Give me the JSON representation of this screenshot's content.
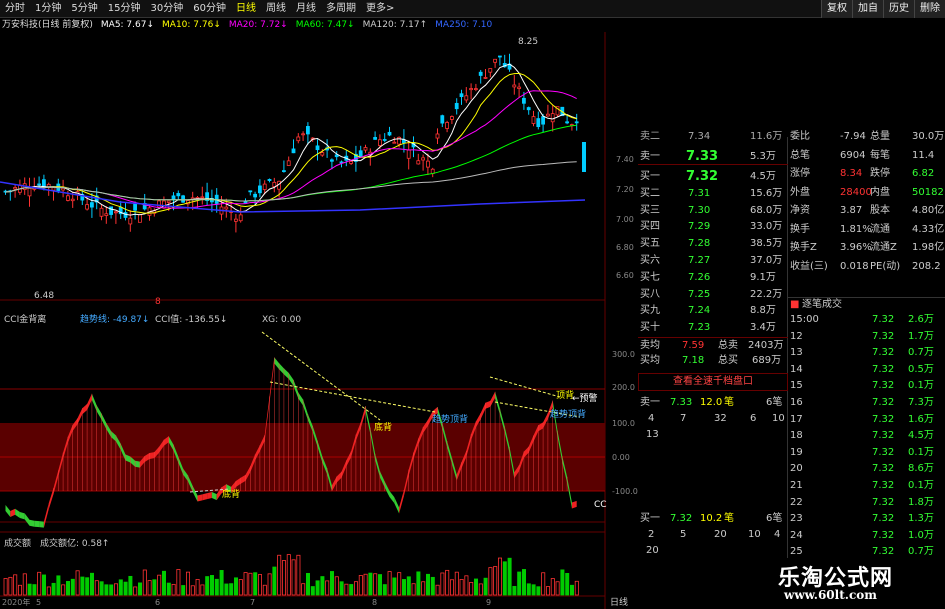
{
  "toolbar": {
    "periods": [
      "分时",
      "1分钟",
      "5分钟",
      "15分钟",
      "30分钟",
      "60分钟",
      "日线",
      "周线",
      "月线",
      "多周期",
      "更多>"
    ],
    "active_period": "日线",
    "right_buttons": [
      "复权",
      "加自",
      "历史",
      "删除"
    ]
  },
  "ma_bar": {
    "stock": "万安科技(日线 前复权)",
    "ma5": "MA5: 7.67↓",
    "ma10": "MA10: 7.76↓",
    "ma20": "MA20: 7.72↓",
    "ma60": "MA60: 7.47↓",
    "ma120": "MA120: 7.17↑",
    "ma250": "MA250: 7.10",
    "colors": {
      "ma5": "#ffffff",
      "ma10": "#ffff00",
      "ma20": "#ff00ff",
      "ma60": "#00ff00",
      "ma120": "#cccccc",
      "ma250": "#3366ff"
    }
  },
  "price_axis": {
    "top_label": "8.25",
    "low_label": "6.48",
    "ticks": [
      "7.40",
      "7.20",
      "7.00",
      "6.80",
      "6.60"
    ]
  },
  "cci_panel": {
    "title": "CCI金背离",
    "trend": "趋势线: -49.87↓",
    "cci": "CCI值: -136.55↓",
    "xg": "XG: 0.00",
    "axis": [
      "300.0",
      "200.0",
      "100.0",
      "0.00",
      "-100.0"
    ],
    "labels": {
      "top_back": "顶背",
      "bottom_back_1": "底背",
      "bottom_back_2": "底背",
      "trend_back": "趋势顶背",
      "trend_back_2": "趋势顶背",
      "top_back_2": "顶背",
      "warning": "←预警",
      "end": "CC"
    },
    "red_marker": "8"
  },
  "volume_panel": {
    "title": "成交额",
    "sub": "成交额亿: 0.58↑",
    "x_labels": [
      "2020年",
      "5",
      "6",
      "7",
      "8",
      "9",
      "日线"
    ]
  },
  "order_book": {
    "partial_top": {
      "label": "卖二",
      "price": "7.34",
      "vol": "11.6万"
    },
    "sell1": {
      "label": "卖一",
      "price": "7.33",
      "vol": "5.3万"
    },
    "buys": [
      {
        "label": "买一",
        "price": "7.32",
        "vol": "4.5万"
      },
      {
        "label": "买二",
        "price": "7.31",
        "vol": "15.6万"
      },
      {
        "label": "买三",
        "price": "7.30",
        "vol": "68.0万"
      },
      {
        "label": "买四",
        "price": "7.29",
        "vol": "33.0万"
      },
      {
        "label": "买五",
        "price": "7.28",
        "vol": "38.5万"
      },
      {
        "label": "买六",
        "price": "7.27",
        "vol": "37.0万"
      },
      {
        "label": "买七",
        "price": "7.26",
        "vol": "9.1万"
      },
      {
        "label": "买八",
        "price": "7.25",
        "vol": "22.2万"
      },
      {
        "label": "买九",
        "price": "7.24",
        "vol": "8.8万"
      },
      {
        "label": "买十",
        "price": "7.23",
        "vol": "3.4万"
      }
    ],
    "sell_avg": {
      "label": "卖均",
      "price": "7.59",
      "tag": "总卖",
      "vol": "2403万"
    },
    "buy_avg": {
      "label": "买均",
      "price": "7.18",
      "tag": "总买",
      "vol": "689万"
    },
    "link": "查看全速千档盘口",
    "queue_sell": {
      "label": "卖一",
      "price": "7.33",
      "vol": "12.0",
      "unit": "笔",
      "count": "6笔",
      "nums1": [
        "4",
        "7",
        "32",
        "6",
        "10"
      ],
      "nums2": [
        "13"
      ]
    },
    "queue_buy": {
      "label": "买一",
      "price": "7.32",
      "vol": "10.2",
      "unit": "笔",
      "count": "6笔",
      "nums1": [
        "2",
        "5",
        "20",
        "10",
        "4"
      ],
      "nums2": [
        "20"
      ]
    }
  },
  "stats": {
    "rows": [
      {
        "k1": "委比",
        "v1": "-7.94",
        "k2": "总量",
        "v2": "30.0万"
      },
      {
        "k1": "总笔",
        "v1": "6904",
        "k2": "每笔",
        "v2": "11.4"
      },
      {
        "k1": "涨停",
        "v1": "8.34",
        "k2": "跌停",
        "v2": "6.82"
      },
      {
        "k1": "外盘",
        "v1": "28400",
        "k2": "内盘",
        "v2": "50182"
      },
      {
        "k1": "净资",
        "v1": "3.87",
        "k2": "股本",
        "v2": "4.80亿"
      },
      {
        "k1": "换手",
        "v1": "1.81%",
        "k2": "流通",
        "v2": "4.33亿"
      },
      {
        "k1": "换手Z",
        "v1": "3.96%",
        "k2": "流通Z",
        "v2": "1.98亿"
      },
      {
        "k1": "收益(三)",
        "v1": "0.018",
        "k2": "PE(动)",
        "v2": "208.2"
      }
    ],
    "ticks_title": "逐笔成交",
    "ticks": [
      {
        "t": "15:00",
        "p": "7.32",
        "v": "2.6万"
      },
      {
        "t": "12",
        "p": "7.32",
        "v": "1.7万"
      },
      {
        "t": "13",
        "p": "7.32",
        "v": "0.7万"
      },
      {
        "t": "14",
        "p": "7.32",
        "v": "0.5万"
      },
      {
        "t": "15",
        "p": "7.32",
        "v": "0.1万"
      },
      {
        "t": "16",
        "p": "7.32",
        "v": "7.3万"
      },
      {
        "t": "17",
        "p": "7.32",
        "v": "1.6万"
      },
      {
        "t": "18",
        "p": "7.32",
        "v": "4.5万"
      },
      {
        "t": "19",
        "p": "7.32",
        "v": "0.1万"
      },
      {
        "t": "20",
        "p": "7.32",
        "v": "8.6万"
      },
      {
        "t": "21",
        "p": "7.32",
        "v": "0.1万"
      },
      {
        "t": "22",
        "p": "7.32",
        "v": "1.8万"
      },
      {
        "t": "23",
        "p": "7.32",
        "v": "1.3万"
      },
      {
        "t": "24",
        "p": "7.32",
        "v": "1.0万"
      },
      {
        "t": "25",
        "p": "7.32",
        "v": "0.7万"
      },
      {
        "t": "26",
        "p": "7.32",
        "v": "0.9万"
      }
    ]
  },
  "watermark": {
    "title": "乐淘公式网",
    "url": "www.60lt.com"
  }
}
